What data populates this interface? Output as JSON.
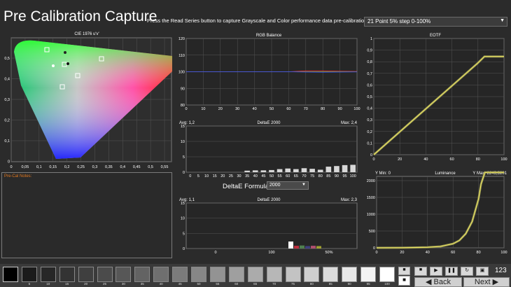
{
  "header": {
    "title": "Pre Calibration Capture",
    "instruction": "Press the Read Series button to capture Grayscale and Color performance data pre-calibration.",
    "preset": "21 Point 5% step 0-100%"
  },
  "cie": {
    "title": "CIE 1976 u'v'",
    "x_ticks": [
      "0",
      "0,05",
      "0,1",
      "0,15",
      "0,2",
      "0,25",
      "0,3",
      "0,35",
      "0,4",
      "0,45",
      "0,5",
      "0,55"
    ],
    "y_ticks": [
      "0,5",
      "0,4",
      "0,3",
      "0,2",
      "0,1",
      "0"
    ]
  },
  "notes": {
    "label": "Pre-Cal Notes:"
  },
  "rgb_balance": {
    "title": "RGB Balance",
    "y_ticks": [
      "120",
      "110",
      "100",
      "90",
      "80"
    ],
    "x_ticks": [
      "0",
      "10",
      "20",
      "30",
      "40",
      "50",
      "60",
      "70",
      "80",
      "90",
      "100"
    ]
  },
  "deltae_gray": {
    "title": "DeltaE 2000",
    "avg": "Avg: 1,2",
    "max": "Max: 2,4",
    "y_ticks": [
      "15",
      "10",
      "5",
      "0"
    ],
    "x_ticks": [
      "0",
      "5",
      "10",
      "15",
      "20",
      "25",
      "30",
      "35",
      "40",
      "45",
      "50",
      "55",
      "60",
      "65",
      "70",
      "75",
      "80",
      "85",
      "90",
      "95",
      "100"
    ]
  },
  "deltae_formula": {
    "label": "DeltaE Formula",
    "value": "2000"
  },
  "deltae_color": {
    "title": "DeltaE 2000",
    "avg": "Avg: 1,1",
    "max": "Max: 2,3",
    "y_ticks": [
      "15",
      "10",
      "5",
      "0"
    ],
    "x_ticks": [
      "0",
      "100",
      "50%"
    ]
  },
  "eotf": {
    "title": "EOTF",
    "y_ticks": [
      "1",
      "0,9",
      "0,8",
      "0,7",
      "0,6",
      "0,5",
      "0,4",
      "0,3",
      "0,2",
      "0,1",
      "0"
    ],
    "x_ticks": [
      "0",
      "20",
      "40",
      "60",
      "80",
      "100"
    ]
  },
  "luminance": {
    "title": "Luminance",
    "ymin": "Y Min: 0",
    "ymax": "Y Max: 2245,5201",
    "y_ticks": [
      "2000",
      "1500",
      "1000",
      "500",
      "0"
    ],
    "x_ticks": [
      "0",
      "20",
      "40",
      "60",
      "80",
      "100"
    ]
  },
  "bottom": {
    "swatch_labels": [
      "",
      "5",
      "10",
      "15",
      "20",
      "25",
      "30",
      "35",
      "40",
      "45",
      "50",
      "55",
      "60",
      "65",
      "70",
      "75",
      "80",
      "85",
      "90",
      "95",
      "100"
    ],
    "back": "Back",
    "next": "Next",
    "counter": "123"
  },
  "colors": {
    "background": "#2b2b2b",
    "grid": "#555555",
    "red": "#ff3030",
    "green": "#40c040",
    "blue": "#4040ff",
    "eotf_line": "#e8e060",
    "bar": "#d8d8d8"
  },
  "chart_data": [
    {
      "type": "line",
      "title": "RGB Balance",
      "x": [
        0,
        10,
        20,
        30,
        40,
        50,
        60,
        70,
        80,
        90,
        100
      ],
      "series": [
        {
          "values": [
            100,
            100,
            100,
            100,
            100,
            100,
            100,
            100.5,
            100.5,
            100.3,
            100.2
          ]
        },
        {
          "values": [
            100,
            100,
            100,
            100,
            100,
            100,
            100,
            100,
            100,
            100,
            100
          ]
        },
        {
          "values": [
            100,
            100,
            100,
            100,
            100,
            100,
            100,
            99.8,
            99.7,
            99.8,
            99.9
          ]
        }
      ],
      "ylim": [
        80,
        120
      ],
      "xlim": [
        0,
        100
      ]
    },
    {
      "type": "bar",
      "title": "DeltaE 2000",
      "categories": [
        "0",
        "5",
        "10",
        "15",
        "20",
        "25",
        "30",
        "35",
        "40",
        "45",
        "50",
        "55",
        "60",
        "65",
        "70",
        "75",
        "80",
        "85",
        "90",
        "95",
        "100"
      ],
      "values": [
        0,
        0,
        0,
        0,
        0,
        0,
        0,
        0.5,
        0.6,
        0.6,
        0.7,
        1.0,
        1.2,
        1.0,
        1.3,
        1.1,
        0.8,
        1.8,
        2.0,
        2.3,
        2.4
      ],
      "ylim": [
        0,
        15
      ]
    },
    {
      "type": "bar",
      "title": "DeltaE 2000",
      "values": [
        2.3,
        0.9,
        1.0,
        0.8,
        0.9,
        0.8
      ],
      "ylim": [
        0,
        15
      ]
    },
    {
      "type": "line",
      "title": "EOTF",
      "series": [
        {
          "x": [
            0,
            80,
            85,
            100
          ],
          "values": [
            0,
            0.79,
            0.845,
            0.845
          ]
        }
      ],
      "xlim": [
        0,
        100
      ],
      "ylim": [
        0,
        1
      ]
    },
    {
      "type": "line",
      "title": "Luminance",
      "series": [
        {
          "x": [
            0,
            20,
            40,
            50,
            60,
            65,
            70,
            75,
            80,
            82,
            85,
            100
          ],
          "values": [
            0,
            3,
            15,
            40,
            120,
            220,
            420,
            780,
            1450,
            1900,
            2245,
            2245
          ]
        }
      ],
      "xlim": [
        0,
        100
      ],
      "ylim": [
        0,
        2250
      ]
    }
  ]
}
